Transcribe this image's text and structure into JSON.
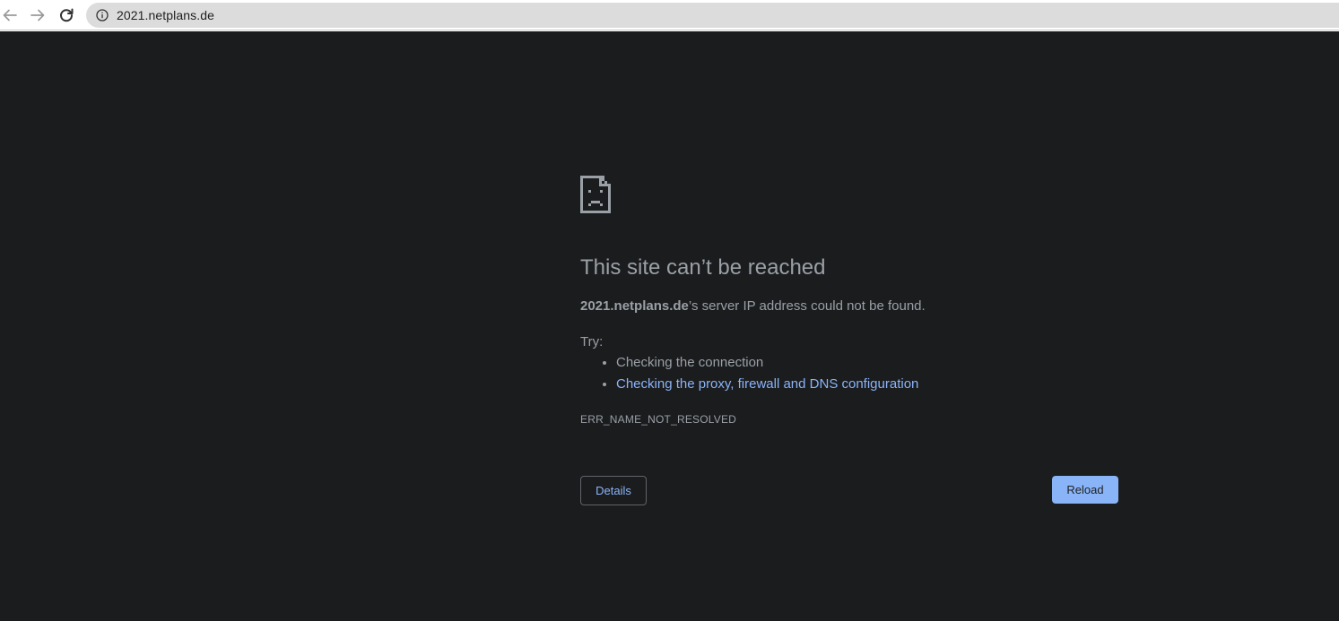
{
  "browser": {
    "url": "2021.netplans.de",
    "icons": {
      "back": "arrow-left-icon",
      "forward": "arrow-right-icon",
      "reload": "reload-icon",
      "site_info": "info-icon"
    }
  },
  "error_page": {
    "icon": "sad-page-icon",
    "title": "This site can’t be reached",
    "host": "2021.netplans.de",
    "description_suffix": "’s server IP address could not be found.",
    "try_label": "Try:",
    "suggestions": [
      "Checking the connection",
      "Checking the proxy, firewall and DNS configuration"
    ],
    "error_code": "ERR_NAME_NOT_RESOLVED",
    "details_label": "Details",
    "reload_label": "Reload"
  },
  "colors": {
    "page_background": "#1b1c1e",
    "text": "#9aa0a6",
    "link": "#8ab4f8",
    "primary_button": "#8ab4f8"
  }
}
